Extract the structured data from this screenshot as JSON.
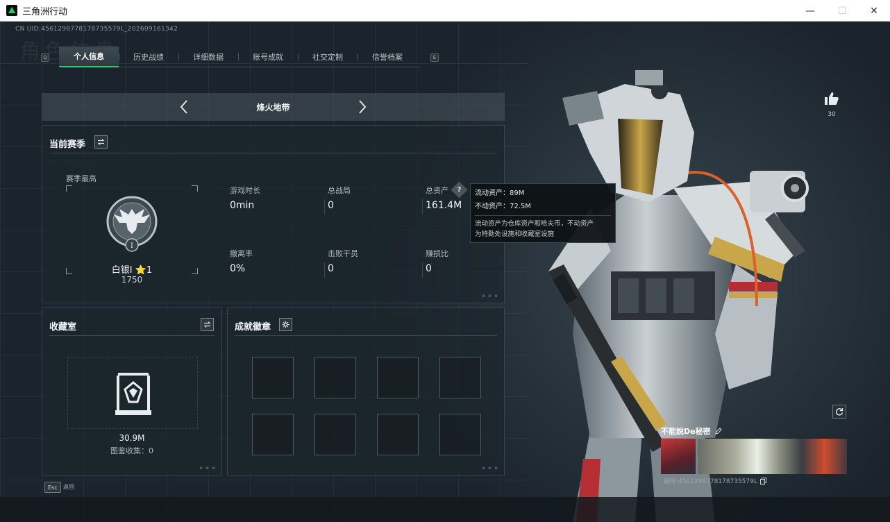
{
  "window": {
    "title": "三角洲行动",
    "minimize": "—",
    "maximize": "☐",
    "close": "✕"
  },
  "header": {
    "uid": "CN UID:4561298778178735579L_202609161342",
    "watermark": "角色信息",
    "key_left": "Q",
    "key_right": "E"
  },
  "tabs": [
    {
      "label": "个人信息",
      "active": true
    },
    {
      "label": "历史战绩",
      "active": false
    },
    {
      "label": "详细数据",
      "active": false
    },
    {
      "label": "账号成就",
      "active": false
    },
    {
      "label": "社交定制",
      "active": false
    },
    {
      "label": "信誉档案",
      "active": false
    }
  ],
  "map_selector": {
    "title": "烽火地带"
  },
  "season": {
    "title": "当前赛季",
    "best_label": "赛季最高",
    "rank_name": "白银I ⭐1",
    "rank_score": "1750",
    "stats": [
      {
        "label": "游戏时长",
        "value": "0min"
      },
      {
        "label": "总战局",
        "value": "0"
      },
      {
        "label": "总资产",
        "value": "161.4M"
      },
      {
        "label": "撤离率",
        "value": "0%"
      },
      {
        "label": "击败干员",
        "value": "0"
      },
      {
        "label": "赚损比",
        "value": "0"
      }
    ],
    "help": "?"
  },
  "tooltip": {
    "liquid": "流动资产：89M",
    "fixed": "不动资产：72.5M",
    "desc_line1": "流动资产为仓库资产和哈夫币，不动资产",
    "desc_line2": "为特勤处设施和收藏室设施"
  },
  "collection": {
    "title": "收藏室",
    "value": "30.9M",
    "count_label": "图鉴收集：0"
  },
  "achievements": {
    "title": "成就徽章",
    "slots": 8
  },
  "profile": {
    "like_count": "30",
    "player_name": "不能說De秘密",
    "player_id": "编号:4561298778178735579L"
  },
  "footer": {
    "esc_key": "Esc",
    "esc_label": "返回"
  },
  "colors": {
    "accent": "#19d27a",
    "panel_border": "#38454e",
    "text_primary": "#f2f5f6",
    "text_secondary": "#aeb8be"
  }
}
